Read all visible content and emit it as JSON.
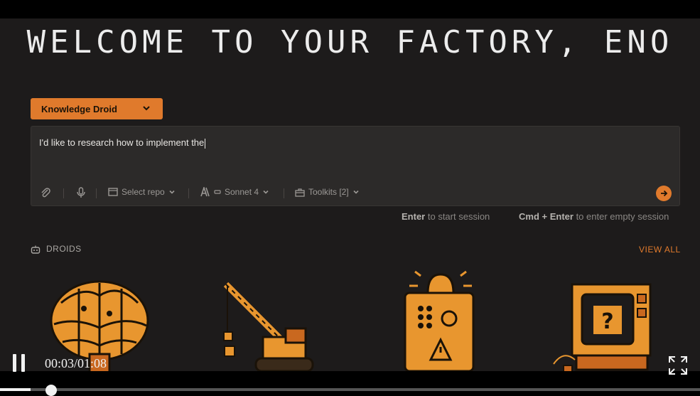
{
  "page": {
    "title": "WELCOME TO YOUR FACTORY, ENO"
  },
  "droid_selector": {
    "label": "Knowledge Droid",
    "icon": "chevron-down-icon"
  },
  "prompt": {
    "value": "I'd like to research how to implement the",
    "toolbar": {
      "attach_icon": "paperclip-icon",
      "mic_icon": "microphone-icon",
      "repo_label": "Select repo",
      "model_label": "Sonnet 4",
      "toolkits_label": "Toolkits [2]",
      "send_icon": "arrow-right-icon"
    }
  },
  "hints": {
    "enter_key": "Enter",
    "enter_text": "to start session",
    "cmd_key": "Cmd + Enter",
    "cmd_text": "to enter empty session"
  },
  "droids": {
    "heading": "DROIDS",
    "view_all": "VIEW ALL",
    "items": [
      "knowledge-droid-brain",
      "construction-droid-crane",
      "alert-droid-siren",
      "help-droid-computer"
    ]
  },
  "video": {
    "current_time": "00:03",
    "duration": "01:08",
    "time_text": "00:03/01:08",
    "progress": 0.044
  },
  "colors": {
    "accent": "#e07a2c",
    "background": "#1d1b1b",
    "input_bg": "#2c2a29"
  }
}
